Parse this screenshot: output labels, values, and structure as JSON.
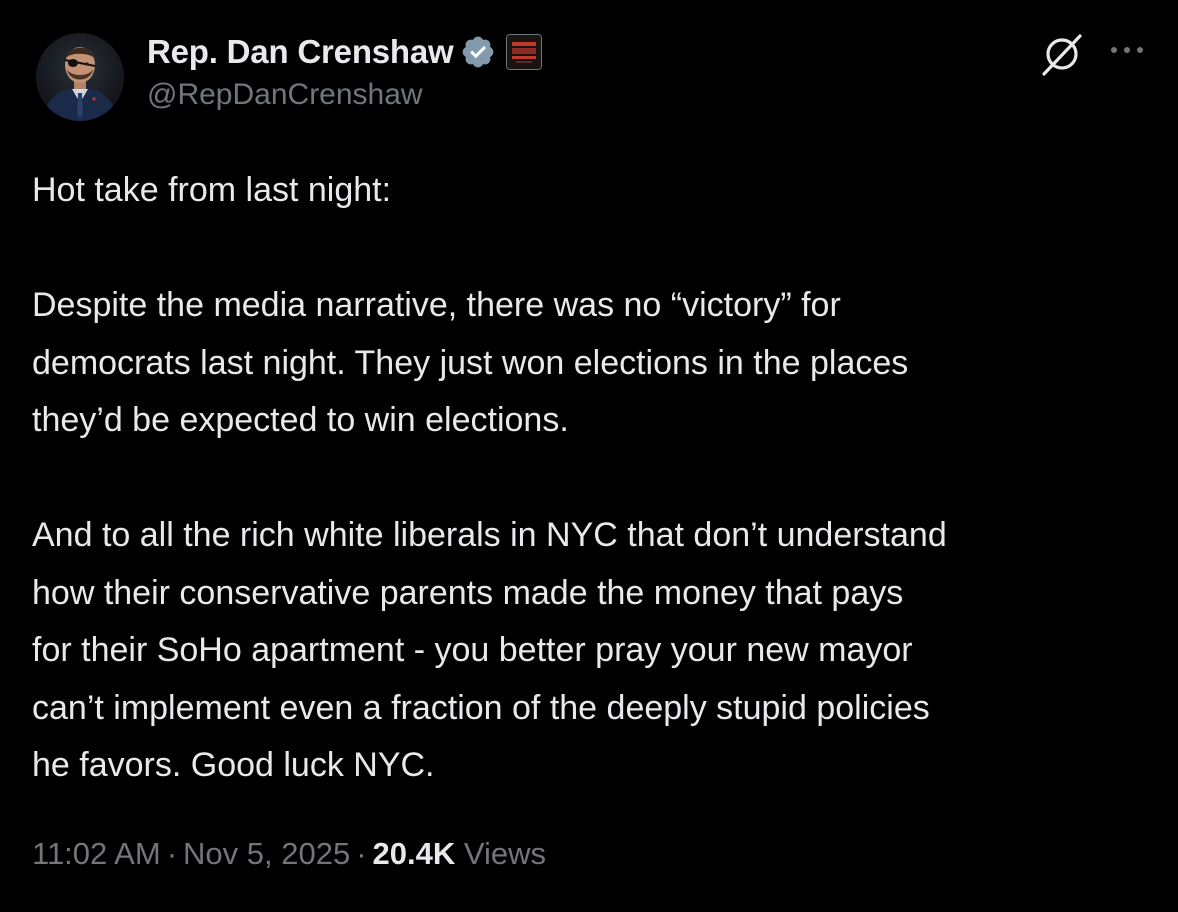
{
  "author": {
    "display_name": "Rep. Dan Crenshaw",
    "handle": "@RepDanCrenshaw"
  },
  "tweet": {
    "lines": [
      "Hot take from last night:",
      "",
      "Despite the media narrative, there was no “victory” for",
      "democrats last night. They just won elections in the places",
      "they’d be expected to win elections.",
      "",
      "And to all the rich white liberals in NYC that don’t understand",
      "how their conservative parents made the money that pays",
      "for their SoHo apartment - you better pray your new mayor",
      "can’t implement even a fraction of the deeply stupid policies",
      "he favors. Good luck NYC."
    ]
  },
  "meta": {
    "time": "11:02 AM",
    "separator": "·",
    "date": "Nov 5, 2025",
    "views_count": "20.4K",
    "views_label": "Views"
  },
  "icons": {
    "verified": "verified-badge-icon",
    "affiliate": "affiliate-badge-icon",
    "grok": "grok-icon",
    "more": "more-options-icon"
  },
  "colors": {
    "background": "#000000",
    "primary_text": "#e7e9ea",
    "secondary_text": "#71767b",
    "verified_badge": "#829aab"
  }
}
